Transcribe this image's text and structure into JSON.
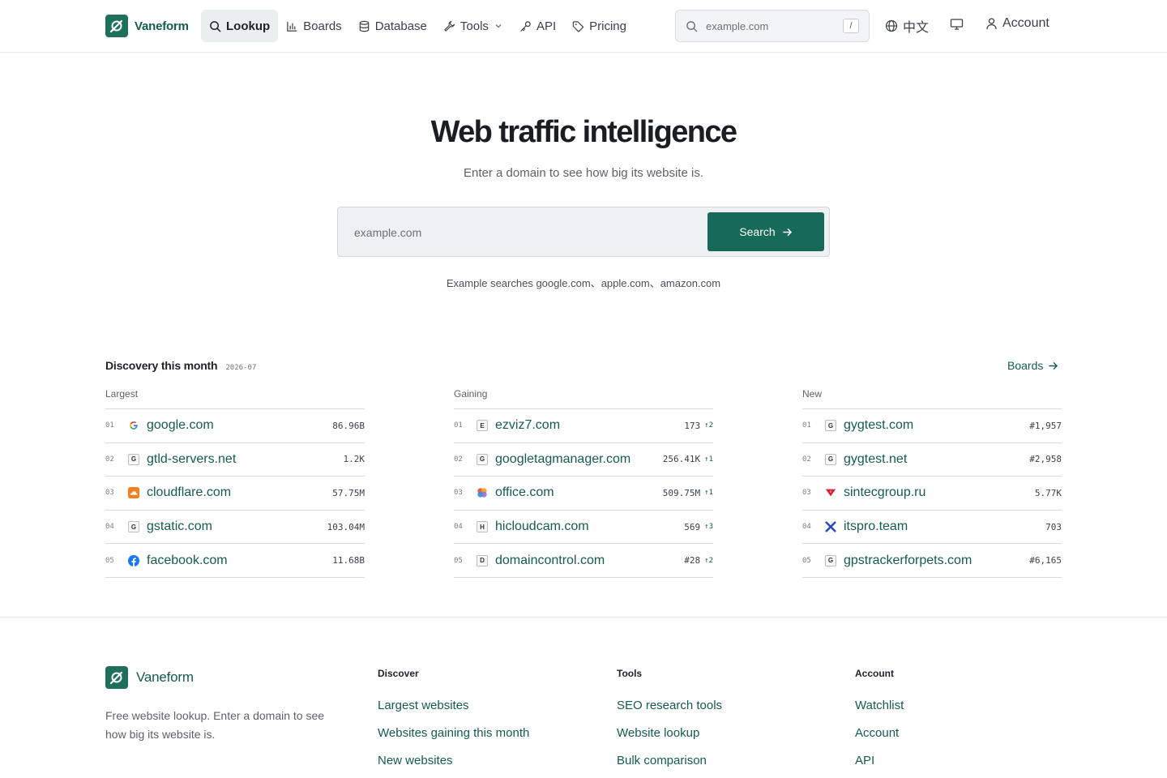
{
  "header": {
    "brand": "Vaneform",
    "nav": [
      {
        "label": "Lookup",
        "icon": "search-icon"
      },
      {
        "label": "Boards",
        "icon": "bar-chart-icon"
      },
      {
        "label": "Database",
        "icon": "database-icon"
      },
      {
        "label": "Tools",
        "icon": "wrench-icon"
      },
      {
        "label": "API",
        "icon": "key-icon"
      },
      {
        "label": "Pricing",
        "icon": "tag-icon"
      }
    ],
    "search_placeholder": "example.com",
    "search_shortcut": "/",
    "language_label": "中文",
    "account_label": "Account"
  },
  "hero": {
    "title": "Web traffic intelligence",
    "subtitle": "Enter a domain to see how big its website is.",
    "search_placeholder": "example.com",
    "search_button": "Search",
    "examples_prefix": "Example searches",
    "examples": [
      "google.com",
      "apple.com",
      "amazon.com"
    ],
    "examples_separator": "、"
  },
  "discovery": {
    "title": "Discovery this month",
    "date": "2026-07",
    "boards_link": "Boards",
    "columns": [
      {
        "title": "Largest",
        "rows": [
          {
            "rank": "01",
            "favicon": "google-g",
            "letter": "G",
            "domain": "google.com",
            "metric": "86.96B",
            "delta": ""
          },
          {
            "rank": "02",
            "favicon": "letter",
            "letter": "G",
            "domain": "gtld-servers.net",
            "metric": "1.2K",
            "delta": ""
          },
          {
            "rank": "03",
            "favicon": "cloudflare",
            "letter": "",
            "domain": "cloudflare.com",
            "metric": "57.75M",
            "delta": ""
          },
          {
            "rank": "04",
            "favicon": "letter",
            "letter": "G",
            "domain": "gstatic.com",
            "metric": "103.04M",
            "delta": ""
          },
          {
            "rank": "05",
            "favicon": "facebook",
            "letter": "f",
            "domain": "facebook.com",
            "metric": "11.68B",
            "delta": ""
          }
        ]
      },
      {
        "title": "Gaining",
        "rows": [
          {
            "rank": "01",
            "favicon": "letter",
            "letter": "E",
            "domain": "ezviz7.com",
            "metric": "173",
            "delta": "↑2"
          },
          {
            "rank": "02",
            "favicon": "letter",
            "letter": "G",
            "domain": "googletagmanager.com",
            "metric": "256.41K",
            "delta": "↑1"
          },
          {
            "rank": "03",
            "favicon": "office",
            "letter": "",
            "domain": "office.com",
            "metric": "509.75M",
            "delta": "↑1"
          },
          {
            "rank": "04",
            "favicon": "letter",
            "letter": "H",
            "domain": "hicloudcam.com",
            "metric": "569",
            "delta": "↑3"
          },
          {
            "rank": "05",
            "favicon": "letter",
            "letter": "D",
            "domain": "domaincontrol.com",
            "metric": "#28",
            "delta": "↑2"
          }
        ]
      },
      {
        "title": "New",
        "rows": [
          {
            "rank": "01",
            "favicon": "letter",
            "letter": "G",
            "domain": "gygtest.com",
            "metric": "#1,957",
            "delta": ""
          },
          {
            "rank": "02",
            "favicon": "letter",
            "letter": "G",
            "domain": "gygtest.net",
            "metric": "#2,958",
            "delta": ""
          },
          {
            "rank": "03",
            "favicon": "sintec",
            "letter": "",
            "domain": "sintecgroup.ru",
            "metric": "5.77K",
            "delta": ""
          },
          {
            "rank": "04",
            "favicon": "itspro",
            "letter": "X",
            "domain": "itspro.team",
            "metric": "703",
            "delta": ""
          },
          {
            "rank": "05",
            "favicon": "letter",
            "letter": "G",
            "domain": "gpstrackerforpets.com",
            "metric": "#6,165",
            "delta": ""
          }
        ]
      }
    ]
  },
  "footer": {
    "brand": "Vaneform",
    "description": "Free website lookup. Enter a domain to see how big its website is.",
    "columns": [
      {
        "title": "Discover",
        "links": [
          "Largest websites",
          "Websites gaining this month",
          "New websites"
        ]
      },
      {
        "title": "Tools",
        "links": [
          "SEO research tools",
          "Website lookup",
          "Bulk comparison"
        ]
      },
      {
        "title": "Account",
        "links": [
          "Watchlist",
          "Account",
          "API"
        ]
      }
    ]
  },
  "colors": {
    "brand": "#17695a",
    "link": "#145c4c",
    "border": "#d5d8dc"
  }
}
